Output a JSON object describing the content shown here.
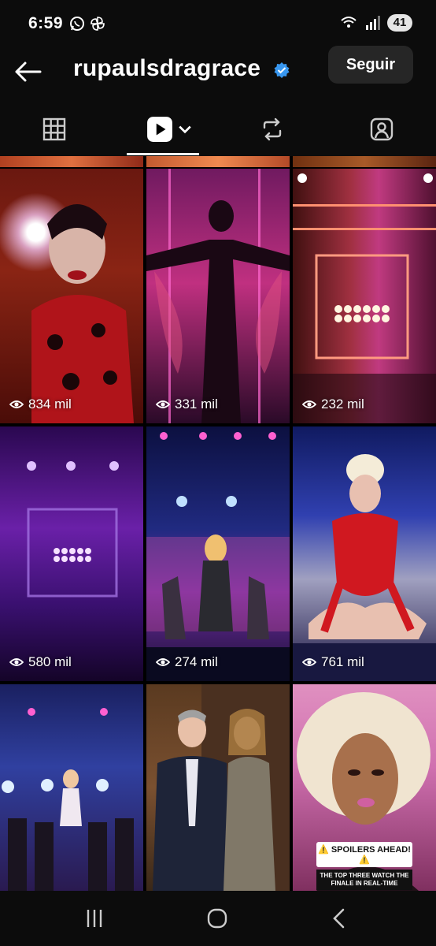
{
  "status_bar": {
    "time": "6:59",
    "battery": "41",
    "icons": [
      "whatsapp-icon",
      "pinwheel-icon",
      "wifi-icon",
      "signal-icon",
      "battery-icon"
    ]
  },
  "header": {
    "username": "rupaulsdragrace",
    "verified": true,
    "follow_label": "Seguir"
  },
  "tabs": [
    {
      "icon": "grid-icon",
      "active": false
    },
    {
      "icon": "reels-icon",
      "active": true
    },
    {
      "icon": "repost-icon",
      "active": false
    },
    {
      "icon": "tagged-icon",
      "active": false
    }
  ],
  "reels": [
    {
      "views": "834 mil",
      "scene": "drag performer in red ladybug costume"
    },
    {
      "views": "331 mil",
      "scene": "silhouette on pink stage"
    },
    {
      "views": "232 mil",
      "scene": "empty stage with lights"
    },
    {
      "views": "580 mil",
      "scene": "empty purple stage"
    },
    {
      "views": "274 mil",
      "scene": "dancers on stage"
    },
    {
      "views": "761 mil",
      "scene": "performer in red bodysuit"
    },
    {
      "views": "",
      "scene": "group performance on stage"
    },
    {
      "views": "",
      "scene": "two hosts in suits"
    },
    {
      "views": "",
      "scene": "host close-up",
      "overlay_title": "⚠️ SPOILERS AHEAD! ⚠️",
      "overlay_text": "THE TOP THREE WATCH THE FINALE IN REAL-TIME"
    }
  ],
  "colors": {
    "background": "#000000",
    "bar": "#0c0c0c",
    "follow_button": "#262626",
    "verified": "#3897f0"
  }
}
